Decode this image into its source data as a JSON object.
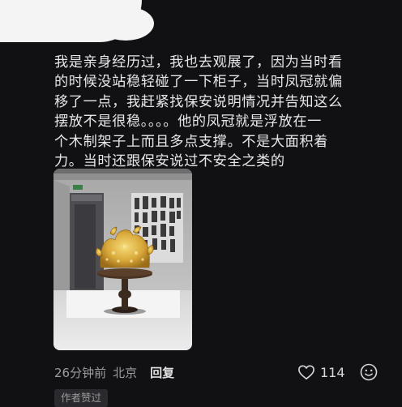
{
  "comment": {
    "text_lines": [
      "我是亲身经历过，我也去观展了，因为当时看",
      "的时候没站稳轻碰了一下柜子，当时凤冠就偏",
      "移了一点，我赶紧找保安说明情况并告知这么",
      "摆放不是很稳。。。。他的凤冠就是浮放在一",
      "个木制架子上而且多点支撑。不是大面积着",
      "力。当时还跟保安说过不安全之类的"
    ],
    "photo_icon": "crown-exhibit-photo"
  },
  "meta": {
    "time": "26分钟前",
    "location": "北京",
    "reply_label": "回复",
    "like_count": "114",
    "like_icon": "heart-icon",
    "emoji_icon": "emoji-icon",
    "author_badge": "作者赞过"
  },
  "colors": {
    "background": "#111114",
    "text": "#e8e8e8",
    "muted": "#9c9c9c",
    "crown_gold": "#d9a93a"
  }
}
